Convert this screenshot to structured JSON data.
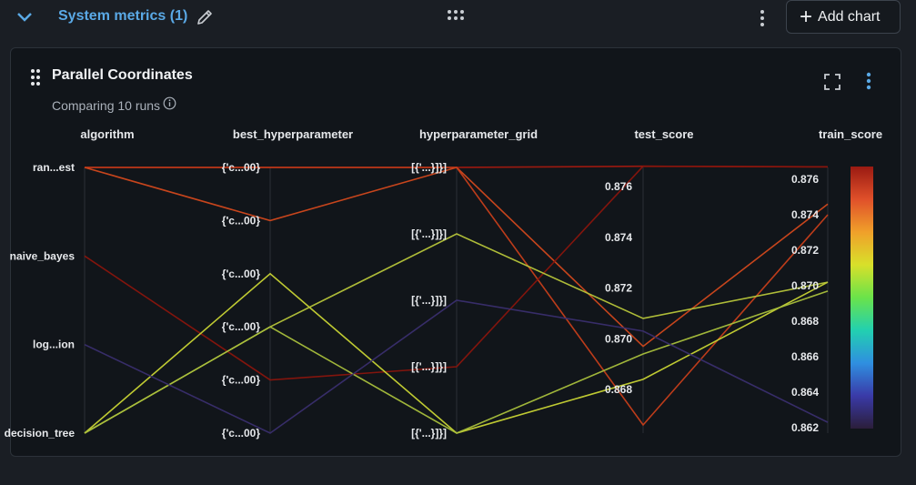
{
  "section": {
    "title": "System metrics (1)"
  },
  "toolbar": {
    "add_chart_label": "Add chart",
    "add_chart_plus": "+"
  },
  "card": {
    "title": "Parallel Coordinates",
    "subtitle": "Comparing 10 runs"
  },
  "chart_data": {
    "type": "parallel_coordinates",
    "dimensions": [
      {
        "name": "algorithm",
        "ticks": [
          "ran...est",
          "naive_bayes",
          "log...ion",
          "decision_tree"
        ]
      },
      {
        "name": "best_hyperparameter",
        "ticks": [
          "{'c...00}",
          "{'c...00}",
          "{'c...00}",
          "{'c...00}",
          "{'c...00}",
          "{'c...00}"
        ]
      },
      {
        "name": "hyperparameter_grid",
        "ticks": [
          "[{'...}]}]",
          "[{'...}]}]",
          "[{'...}]}]",
          "[{'...}]}]",
          "[{'...}]}]"
        ]
      },
      {
        "name": "test_score",
        "ticks": [
          "0.876",
          "0.874",
          "0.872",
          "0.870",
          "0.868"
        ],
        "range": [
          0.8666,
          0.8768
        ]
      },
      {
        "name": "train_score",
        "ticks": [
          "0.876",
          "0.874",
          "0.872",
          "0.870",
          "0.868",
          "0.866",
          "0.864",
          "0.862"
        ],
        "range": [
          0.8619,
          0.8769
        ]
      }
    ],
    "colorscale": [
      "#2b1e3a",
      "#3a3aa8",
      "#2f8fe0",
      "#22d0b0",
      "#6ae34a",
      "#d8e02a",
      "#f0a02a",
      "#e0502a",
      "#9a1a12"
    ],
    "lines": [
      {
        "algorithm": 0,
        "best_hyperparameter": 0,
        "hyperparameter_grid": 0,
        "test_score": 0.8768,
        "train_score": 0.8767,
        "color": "#a4190f"
      },
      {
        "algorithm": 0,
        "best_hyperparameter": 1,
        "hyperparameter_grid": 0,
        "test_score": 0.8697,
        "train_score": 0.8746,
        "color": "#d2481c"
      },
      {
        "algorithm": 0,
        "best_hyperparameter": 0,
        "hyperparameter_grid": 0,
        "test_score": 0.8666,
        "train_score": 0.874,
        "color": "#c73e1a"
      },
      {
        "algorithm": 1,
        "best_hyperparameter": 4,
        "hyperparameter_grid": 3,
        "test_score": 0.8768,
        "train_score": 0.8767,
        "color": "#8a150d"
      },
      {
        "algorithm": 3,
        "best_hyperparameter": 2,
        "hyperparameter_grid": 4,
        "test_score": 0.8684,
        "train_score": 0.8702,
        "color": "#c9d434"
      },
      {
        "algorithm": 3,
        "best_hyperparameter": 3,
        "hyperparameter_grid": 1,
        "test_score": 0.8708,
        "train_score": 0.8702,
        "color": "#b7c53a"
      },
      {
        "algorithm": 3,
        "best_hyperparameter": 3,
        "hyperparameter_grid": 4,
        "test_score": 0.8694,
        "train_score": 0.8697,
        "color": "#a9bf3c"
      },
      {
        "algorithm": 2,
        "best_hyperparameter": 5,
        "hyperparameter_grid": 2,
        "test_score": 0.8703,
        "train_score": 0.8623,
        "color": "#3a2e6e"
      }
    ]
  }
}
